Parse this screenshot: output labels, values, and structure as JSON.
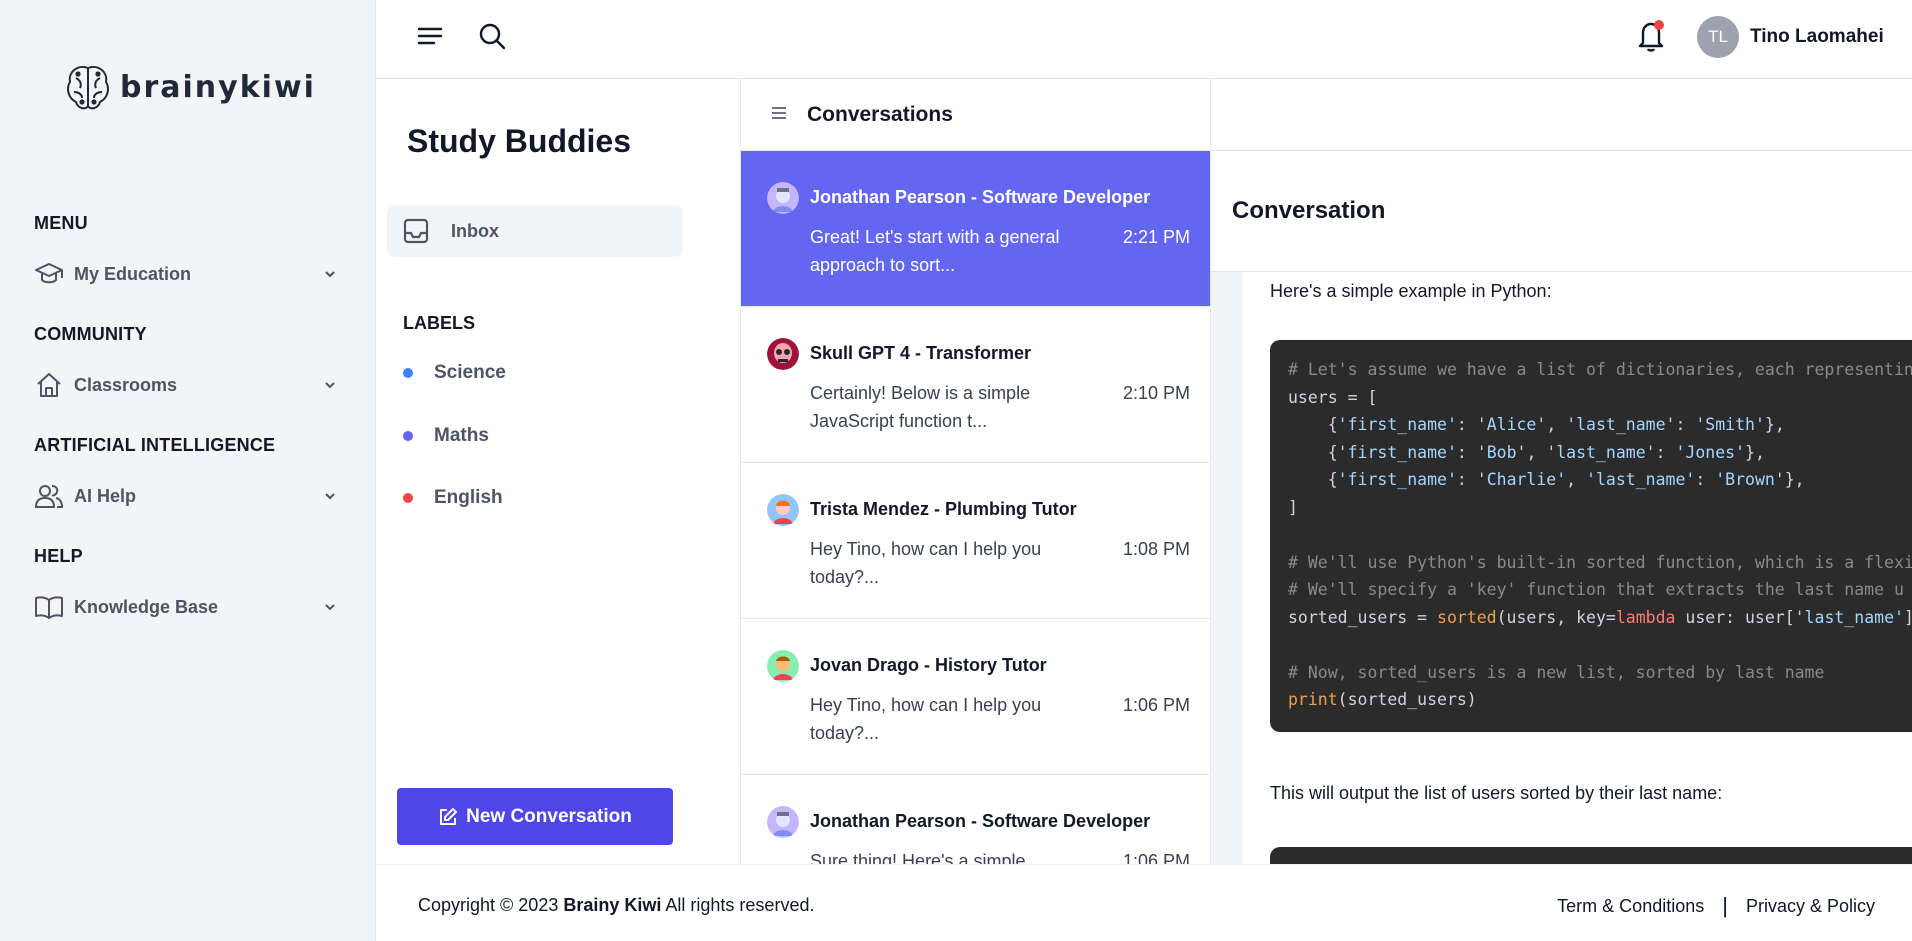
{
  "sidebar": {
    "brand": "brainykiwi",
    "sections": [
      {
        "heading": "MENU",
        "item": "My Education",
        "icon": "graduation-cap-icon"
      },
      {
        "heading": "COMMUNITY",
        "item": "Classrooms",
        "icon": "home-icon"
      },
      {
        "heading": "ARTIFICIAL INTELLIGENCE",
        "item": "AI Help",
        "icon": "users-icon"
      },
      {
        "heading": "HELP",
        "item": "Knowledge Base",
        "icon": "book-icon"
      }
    ]
  },
  "header": {
    "avatar_initials": "TL",
    "username": "Tino Laomahei"
  },
  "buddies": {
    "title": "Study Buddies",
    "inbox_label": "Inbox",
    "labels_heading": "LABELS",
    "labels": [
      {
        "name": "Science",
        "color": "#3b82f6"
      },
      {
        "name": "Maths",
        "color": "#6366f1"
      },
      {
        "name": "English",
        "color": "#ef4444"
      }
    ],
    "new_conversation_label": "New Conversation"
  },
  "conversations": {
    "title": "Conversations",
    "items": [
      {
        "name": "Jonathan Pearson - Software Developer",
        "preview": "Great! Let's start with a general approach to sort...",
        "time": "2:21 PM",
        "active": true
      },
      {
        "name": "Skull GPT 4 - Transformer",
        "preview": "Certainly! Below is a simple JavaScript function t...",
        "time": "2:10 PM"
      },
      {
        "name": "Trista Mendez - Plumbing Tutor",
        "preview": "Hey Tino, how can I help you today?...",
        "time": "1:08 PM"
      },
      {
        "name": "Jovan Drago - History Tutor",
        "preview": "Hey Tino, how can I help you today?...",
        "time": "1:06 PM"
      },
      {
        "name": "Jonathan Pearson - Software Developer",
        "preview": "Sure thing! Here's a simple",
        "time": "1:06 PM"
      }
    ]
  },
  "conversation": {
    "title": "Conversation",
    "intro": "Here's a simple example in Python:",
    "code_lines": [
      "# Let's assume we have a list of dictionaries, each representing a user",
      "users = [",
      "    {'first_name': 'Alice', 'last_name': 'Smith'},",
      "    {'first_name': 'Bob', 'last_name': 'Jones'},",
      "    {'first_name': 'Charlie', 'last_name': 'Brown'},",
      "]",
      "",
      "# We'll use Python's built-in sorted function, which is a flexible",
      "# We'll specify a 'key' function that extracts the last name u",
      "sorted_users = sorted(users, key=lambda user: user['last_name'])",
      "",
      "# Now, sorted_users is a new list, sorted by last name",
      "print(sorted_users)"
    ],
    "outro": "This will output the list of users sorted by their last name:"
  },
  "footer": {
    "copyright_prefix": "Copyright © 2023",
    "company": "Brainy Kiwi",
    "copyright_suffix": "All rights reserved.",
    "terms": "Term & Conditions",
    "privacy": "Privacy & Policy"
  }
}
